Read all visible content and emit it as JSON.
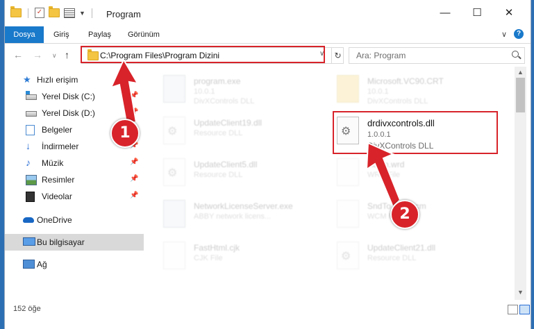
{
  "titlebar": {
    "title": "Program",
    "minimize": "—",
    "maximize": "☐",
    "close": "✕"
  },
  "ribbon": {
    "tabs": [
      "Dosya",
      "Giriş",
      "Paylaş",
      "Görünüm"
    ],
    "expand": "∨",
    "help": "?"
  },
  "nav": {
    "back": "←",
    "forward": "→",
    "recent": "∨",
    "up": "↑",
    "address": "C:\\Program Files\\Program Dizini",
    "dropdown": "∨",
    "refresh": "↻",
    "search_placeholder": "Ara: Program"
  },
  "sidebar": {
    "items": [
      {
        "label": "Hızlı erişim",
        "pinned": false
      },
      {
        "label": "Yerel Disk (C:)",
        "pinned": true
      },
      {
        "label": "Yerel Disk (D:)",
        "pinned": true
      },
      {
        "label": "Belgeler",
        "pinned": true
      },
      {
        "label": "İndirmeler",
        "pinned": true
      },
      {
        "label": "Müzik",
        "pinned": true
      },
      {
        "label": "Resimler",
        "pinned": true
      },
      {
        "label": "Videolar",
        "pinned": true
      },
      {
        "label": "OneDrive",
        "pinned": false
      },
      {
        "label": "Bu bilgisayar",
        "pinned": false,
        "selected": true
      },
      {
        "label": "Ağ",
        "pinned": false
      }
    ],
    "pin_glyph": "📌"
  },
  "files": [
    {
      "name": "program.exe",
      "line2": "10.0.1",
      "line3": "DivXControls DLL"
    },
    {
      "name": "Microsoft.VC90.CRT",
      "line2": "10.0.1",
      "line3": "DivXControls DLL"
    },
    {
      "name": "UpdateClient19.dll",
      "line2": "Resource DLL",
      "line3": ""
    },
    {
      "name": "drdivxcontrols.dll",
      "line2": "1.0.0.1",
      "line3": "DivXControls DLL"
    },
    {
      "name": "UpdateClient5.dll",
      "line2": "Resource DLL",
      "line3": ""
    },
    {
      "name": "Addin.wrd",
      "line2": "WRD File",
      "line3": ""
    },
    {
      "name": "NetworkLicenseServer.exe",
      "line2": "ABBY network licens...",
      "line3": ""
    },
    {
      "name": "SndToTray.wcm",
      "line2": "WCM File",
      "line3": ""
    },
    {
      "name": "FastHtml.cjk",
      "line2": "CJK File",
      "line3": ""
    },
    {
      "name": "UpdateClient21.dll",
      "line2": "Resource DLL",
      "line3": ""
    }
  ],
  "status": {
    "count": "152 öğe"
  },
  "annotations": {
    "step1": "1",
    "step2": "2",
    "color": "#d8232a"
  },
  "colors": {
    "accent": "#1979ca",
    "highlight": "#d8232a"
  }
}
